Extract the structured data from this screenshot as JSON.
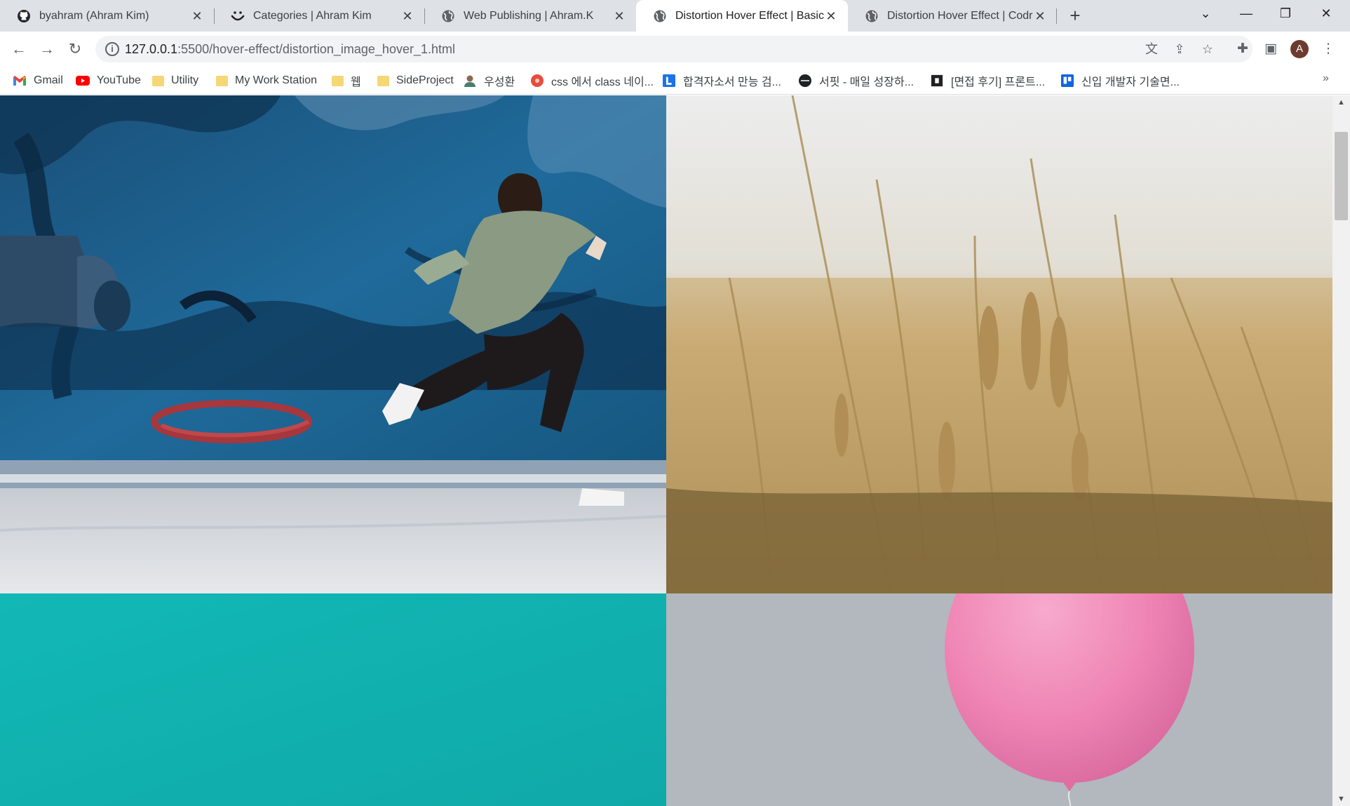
{
  "browser": {
    "tabs": [
      {
        "title": "byahram (Ahram Kim)",
        "icon": "github-icon",
        "active": false
      },
      {
        "title": "Categories | Ahram Kim",
        "icon": "smiley-icon",
        "active": false
      },
      {
        "title": "Web Publishing | Ahram.K",
        "icon": "globe-icon",
        "active": false
      },
      {
        "title": "Distortion Hover Effect | Basic",
        "icon": "globe-icon",
        "active": true
      },
      {
        "title": "Distortion Hover Effect | Codrops",
        "icon": "globe-icon",
        "active": false
      }
    ],
    "new_tab_label": "+",
    "url": {
      "host": "127.0.0.1",
      "rest": ":5500/hover-effect/distortion_image_hover_1.html"
    },
    "avatar_letter": "A",
    "bookmarks": [
      {
        "label": "Gmail",
        "icon": "gmail-icon"
      },
      {
        "label": "YouTube",
        "icon": "youtube-icon"
      },
      {
        "label": "Utility",
        "icon": "folder-icon"
      },
      {
        "label": "My Work Station",
        "icon": "folder-icon"
      },
      {
        "label": "웹",
        "icon": "folder-icon"
      },
      {
        "label": "SideProject",
        "icon": "folder-icon"
      },
      {
        "label": "우성환",
        "icon": "person-icon"
      },
      {
        "label": "css 에서 class 네이...",
        "icon": "red-circle-icon"
      },
      {
        "label": "합격자소서 만능 검...",
        "icon": "l-logo-icon"
      },
      {
        "label": "서핏 - 매일 성장하...",
        "icon": "dark-circle-icon"
      },
      {
        "label": "[면접 후기] 프론트...",
        "icon": "bookmark-dark-icon"
      },
      {
        "label": "신입 개발자 기술면...",
        "icon": "trello-icon"
      }
    ],
    "bookmarks_overflow": "»"
  },
  "page": {
    "images": [
      {
        "name": "jumping-person-mural-image",
        "subject": "person jumping in front of a blue mural"
      },
      {
        "name": "wheat-field-image",
        "subject": "golden wheat stalks"
      },
      {
        "name": "teal-background-image",
        "subject": "solid teal background"
      },
      {
        "name": "pink-balloon-image",
        "subject": "pink balloon on grey sky"
      }
    ]
  },
  "colors": {
    "tabstrip": "#dee1e6",
    "mural_blue": "#1d5f8c",
    "wheat": "#c6a566",
    "teal": "#10b5b4",
    "balloon_pink": "#ef84b4"
  }
}
